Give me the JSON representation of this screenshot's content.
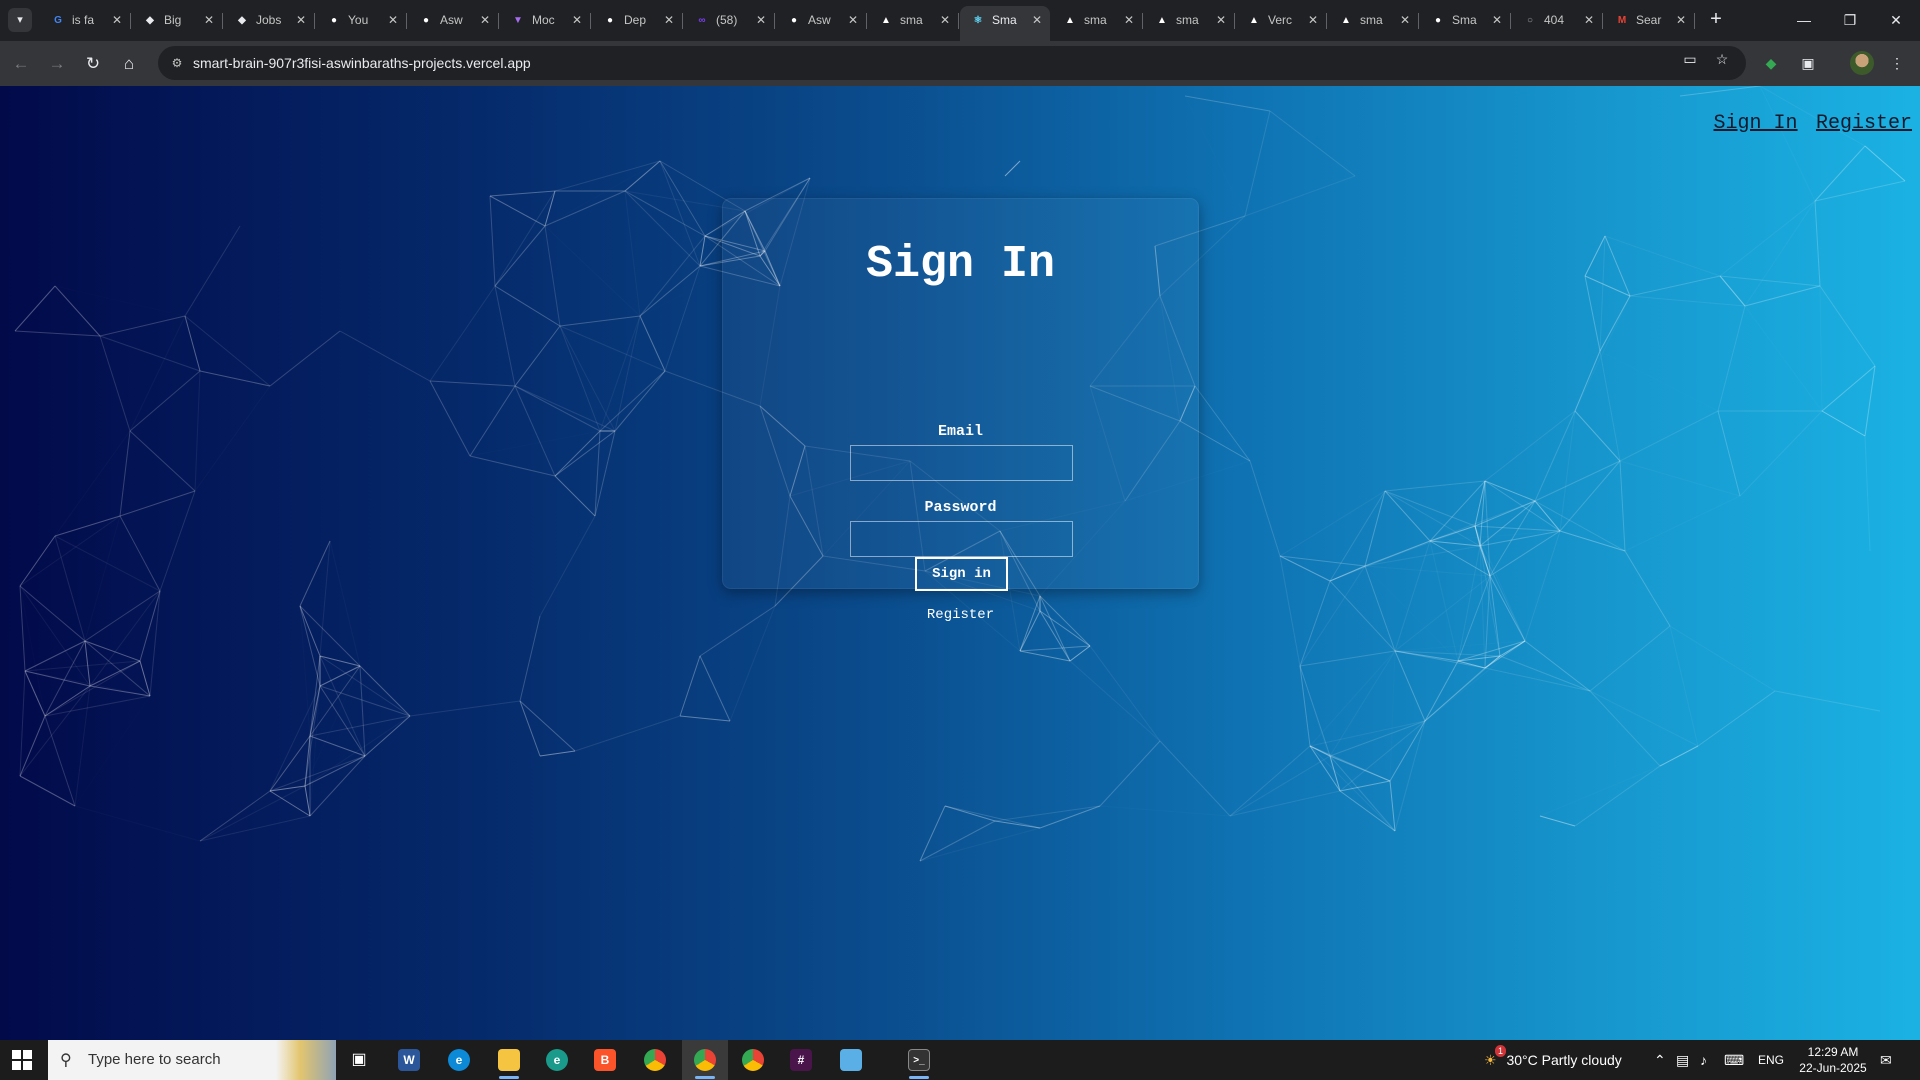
{
  "browser": {
    "tabs": [
      {
        "label": "is fa",
        "icon": "google-icon",
        "color": "#4285f4"
      },
      {
        "label": "Big",
        "icon": "extension-icon",
        "color": "#e8eaed"
      },
      {
        "label": "Jobs",
        "icon": "extension-icon",
        "color": "#e8eaed"
      },
      {
        "label": "You",
        "icon": "github-icon",
        "color": "#ffffff"
      },
      {
        "label": "Asw",
        "icon": "github-icon",
        "color": "#ffffff"
      },
      {
        "label": "Moc",
        "icon": "vite-icon",
        "color": "#a86cf0"
      },
      {
        "label": "Dep",
        "icon": "github-icon",
        "color": "#ffffff"
      },
      {
        "label": "(58)",
        "icon": "app-icon",
        "color": "#7b3ff2"
      },
      {
        "label": "Asw",
        "icon": "github-icon",
        "color": "#ffffff"
      },
      {
        "label": "sma",
        "icon": "vercel-icon",
        "color": "#ffffff"
      },
      {
        "label": "Sma",
        "icon": "react-icon",
        "color": "#61dafb",
        "active": true
      },
      {
        "label": "sma",
        "icon": "vercel-icon",
        "color": "#ffffff"
      },
      {
        "label": "sma",
        "icon": "vercel-icon",
        "color": "#ffffff"
      },
      {
        "label": "Verc",
        "icon": "vercel-icon",
        "color": "#ffffff"
      },
      {
        "label": "sma",
        "icon": "vercel-icon",
        "color": "#ffffff"
      },
      {
        "label": "Sma",
        "icon": "github-icon",
        "color": "#ffffff"
      },
      {
        "label": "404",
        "icon": "globe-icon",
        "color": "#9aa0a6"
      },
      {
        "label": "Sear",
        "icon": "gmail-icon",
        "color": "#ea4335"
      }
    ],
    "url": "smart-brain-907r3fisi-aswinbaraths-projects.vercel.app"
  },
  "page": {
    "nav": {
      "signin": "Sign In",
      "register": "Register"
    },
    "card": {
      "title": "Sign In",
      "email_label": "Email",
      "email_value": "",
      "password_label": "Password",
      "password_value": "",
      "submit_label": "Sign in",
      "register_label": "Register"
    }
  },
  "taskbar": {
    "search_placeholder": "Type here to search",
    "weather": "30°C  Partly cloudy",
    "weather_badge": "1",
    "language": "ENG",
    "time": "12:29 AM",
    "date": "22-Jun-2025"
  }
}
